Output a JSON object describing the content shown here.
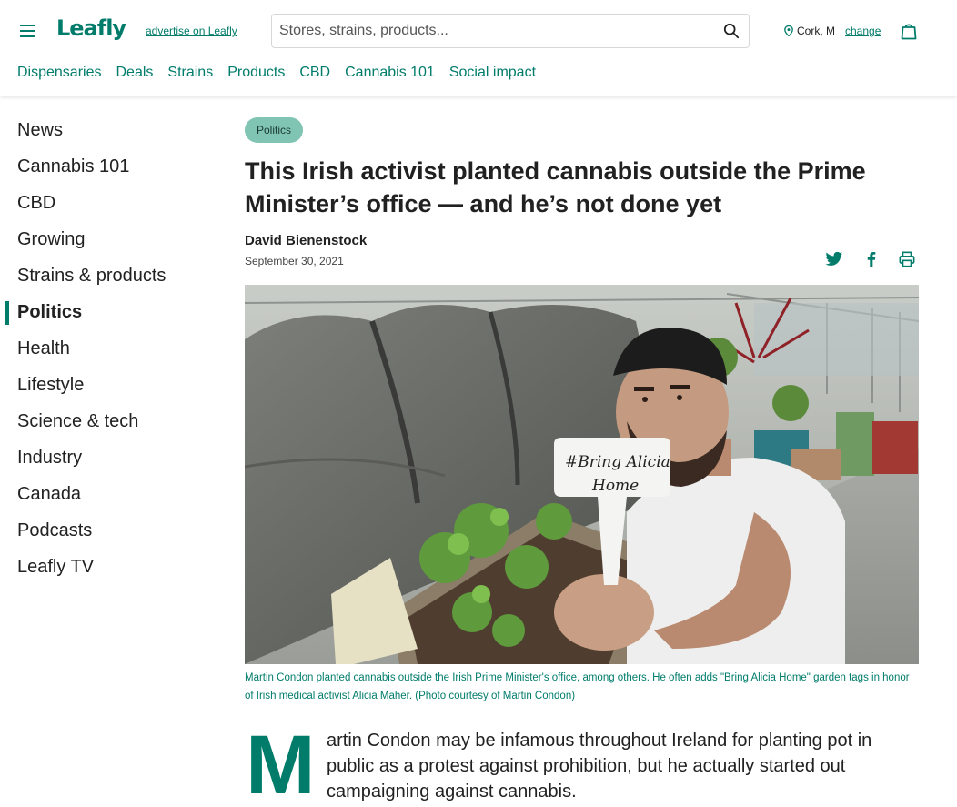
{
  "header": {
    "logo": "Leafly",
    "advertise_link": "advertise on Leafly",
    "search_placeholder": "Stores, strains, products...",
    "location_text": "Cork, M",
    "change_link": "change"
  },
  "nav": {
    "items": [
      {
        "label": "Dispensaries"
      },
      {
        "label": "Deals"
      },
      {
        "label": "Strains"
      },
      {
        "label": "Products"
      },
      {
        "label": "CBD"
      },
      {
        "label": "Cannabis 101"
      },
      {
        "label": "Social impact"
      }
    ]
  },
  "sidebar": {
    "items": [
      {
        "label": "News"
      },
      {
        "label": "Cannabis 101"
      },
      {
        "label": "CBD"
      },
      {
        "label": "Growing"
      },
      {
        "label": "Strains & products"
      },
      {
        "label": "Politics",
        "active": true
      },
      {
        "label": "Health"
      },
      {
        "label": "Lifestyle"
      },
      {
        "label": "Science & tech"
      },
      {
        "label": "Industry"
      },
      {
        "label": "Canada"
      },
      {
        "label": "Podcasts"
      },
      {
        "label": "Leafly TV"
      }
    ]
  },
  "article": {
    "tag": "Politics",
    "title": "This Irish activist planted cannabis outside the Prime Minister’s office — and he’s not done yet",
    "author": "David Bienenstock",
    "date": "September 30, 2021",
    "photo_sign_text_1": "#Bring Alicia",
    "photo_sign_text_2": "Home",
    "caption": "Martin Condon planted cannabis outside the Irish Prime Minister's office, among others. He often adds \"Bring Alicia Home\" garden tags in honor of Irish medical activist Alicia Maher. (Photo courtesy of Martin Condon)",
    "dropcap": "M",
    "body_first": "artin Condon may be infamous throughout Ireland for planting pot in public as a protest against prohibition, but he actually started out campaigning against cannabis."
  },
  "colors": {
    "brand": "#017c6b",
    "tag_bg": "#80c4b3"
  },
  "icons": [
    "menu-icon",
    "search-icon",
    "location-pin-icon",
    "shopping-bag-icon",
    "twitter-icon",
    "facebook-icon",
    "print-icon"
  ]
}
